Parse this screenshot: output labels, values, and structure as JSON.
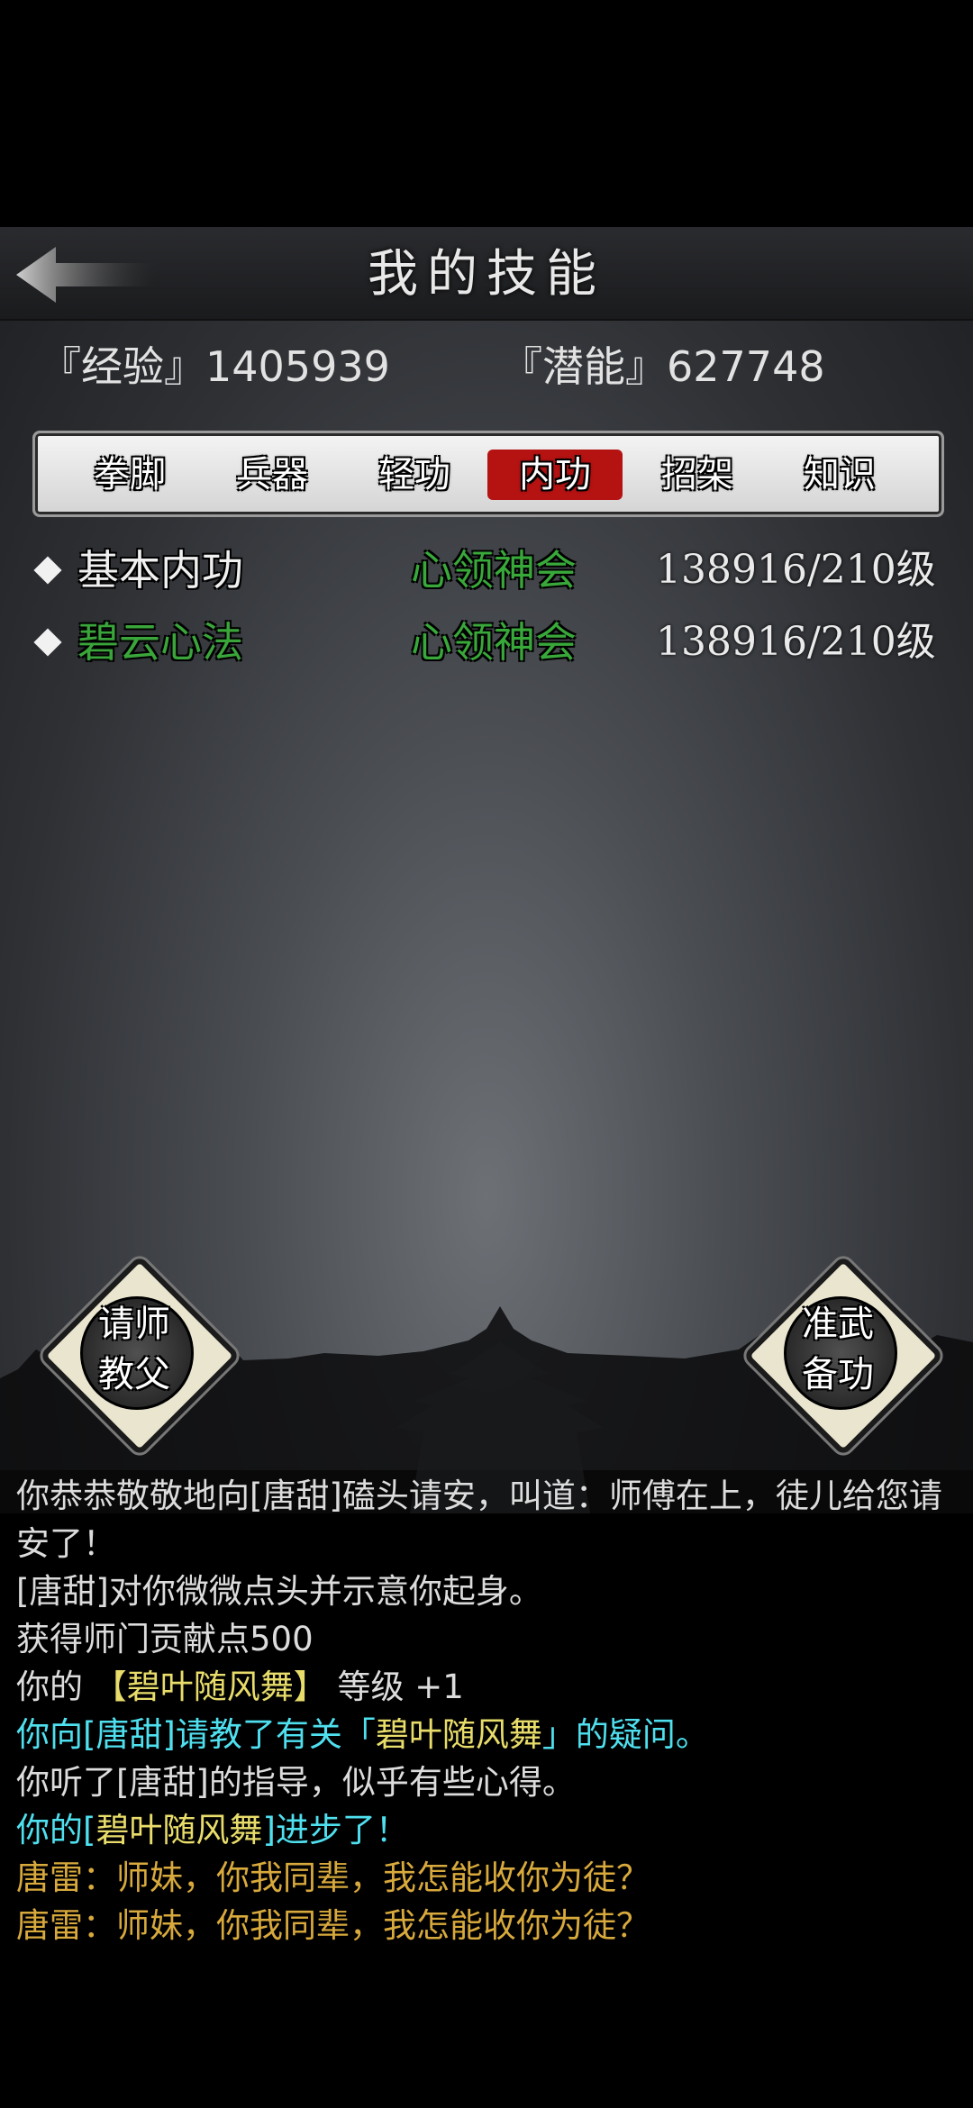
{
  "header": {
    "title": "我的技能"
  },
  "stats": {
    "exp": "『经验』1405939",
    "potential": "『潜能』627748"
  },
  "tabs": [
    {
      "label": "拳脚",
      "active": false
    },
    {
      "label": "兵器",
      "active": false
    },
    {
      "label": "轻功",
      "active": false
    },
    {
      "label": "内功",
      "active": true
    },
    {
      "label": "招架",
      "active": false
    },
    {
      "label": "知识",
      "active": false
    }
  ],
  "skills": [
    {
      "name": "基本内功",
      "name_color": "#f0f0f0",
      "level": "心领神会",
      "progress": "138916/210级"
    },
    {
      "name": "碧云心法",
      "name_color": "#3aa53a",
      "level": "心领神会",
      "progress": "138916/210级"
    }
  ],
  "buttons": {
    "ask_master": [
      "请师",
      "教父"
    ],
    "prepare_skills": [
      "准武",
      "备功"
    ]
  },
  "log": [
    {
      "parts": [
        {
          "text": "你恭恭敬敬地向[唐甜]磕头请安，叫道：师傅在上，徒儿给您请安了！",
          "color": "white"
        }
      ]
    },
    {
      "parts": [
        {
          "text": "[唐甜]对你微微点头并示意你起身。",
          "color": "white"
        }
      ]
    },
    {
      "parts": [
        {
          "text": "获得师门贡献点500",
          "color": "white"
        }
      ]
    },
    {
      "parts": [
        {
          "text": "你的 ",
          "color": "white"
        },
        {
          "text": "【碧叶随风舞】",
          "color": "yellow"
        },
        {
          "text": " 等级 +1",
          "color": "white"
        }
      ]
    },
    {
      "parts": [
        {
          "text": "你向[唐甜]请教了有关「",
          "color": "cyan"
        },
        {
          "text": "碧叶随风舞",
          "color": "yellow"
        },
        {
          "text": "」的疑问。",
          "color": "cyan"
        }
      ]
    },
    {
      "parts": [
        {
          "text": "你听了[唐甜]的指导，似乎有些心得。",
          "color": "white"
        }
      ]
    },
    {
      "parts": [
        {
          "text": "你的[",
          "color": "cyan"
        },
        {
          "text": "碧叶随风舞",
          "color": "yellow"
        },
        {
          "text": "]进步了！",
          "color": "cyan"
        }
      ]
    },
    {
      "parts": [
        {
          "text": "唐雷：师妹，你我同辈，我怎能收你为徒？",
          "color": "orange"
        }
      ]
    },
    {
      "parts": [
        {
          "text": "唐雷：师妹，你我同辈，我怎能收你为徒？",
          "color": "orange"
        }
      ]
    }
  ]
}
